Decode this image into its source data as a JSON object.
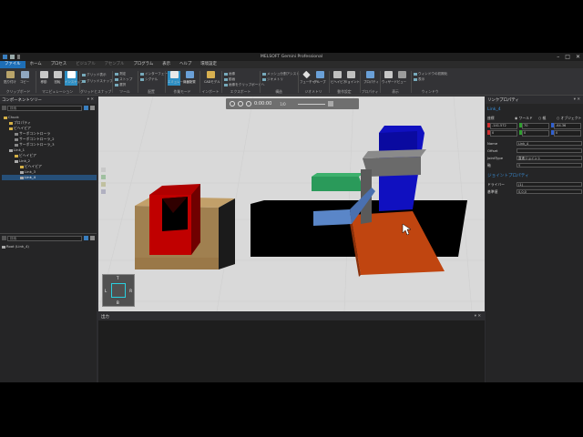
{
  "window": {
    "title": "MELSOFT Gemini Professional",
    "controls": [
      "–",
      "□",
      "✕"
    ]
  },
  "menu": [
    "ファイル",
    "ホーム",
    "プロセス",
    "ビジュアル",
    "アセンブル",
    "プログラム",
    "表示",
    "ヘルプ",
    "環境設定"
  ],
  "ribbon": {
    "groups": [
      {
        "label": "クリップボード",
        "buttons": [
          "貼り付け",
          "コピー"
        ]
      },
      {
        "label": "マニピュレーション",
        "buttons": [
          "移動",
          "回転",
          "インスナップ"
        ]
      },
      {
        "label": "グリッドとスナップ",
        "smalls": [
          "グリッド表示",
          "グリッドスナップ"
        ]
      },
      {
        "label": "ツール",
        "smalls": [
          "測定",
          "ストップ",
          "選択"
        ]
      },
      {
        "label": "配置",
        "smalls": [
          "インターフェース",
          "シグナル"
        ]
      },
      {
        "label": "作業モード",
        "buttons": [
          "エミュレーション",
          "機器配置"
        ]
      },
      {
        "label": "インポート",
        "buttons": [
          "CADモデル"
        ]
      },
      {
        "label": "エクスポート",
        "smalls": [
          "画像",
          "動画",
          "画像をクリップボードへ"
        ]
      },
      {
        "label": "構造",
        "smalls": [
          "メッシュ分割アシスト",
          "ジオメトリ"
        ]
      },
      {
        "label": "ジオメトリ",
        "buttons": [
          "フューチャー",
          "グループ"
        ]
      },
      {
        "label": "動作設定",
        "buttons": [
          "ビヘイビア",
          "ジョイント"
        ]
      },
      {
        "label": "プロパティ",
        "buttons": [
          "プロパティ"
        ]
      },
      {
        "label": "表示",
        "buttons": [
          "ウィザード",
          "ビュー"
        ]
      },
      {
        "label": "ウィンドウ",
        "smalls": [
          "ウィンドウの初期化",
          "表示"
        ]
      }
    ]
  },
  "left_panel": {
    "title": "コンポーネントツリー",
    "search_placeholder": "検索",
    "tree": [
      {
        "label": "Chuck",
        "depth": 0
      },
      {
        "label": "プロパティ",
        "depth": 1
      },
      {
        "label": "ビヘイビア",
        "depth": 1
      },
      {
        "label": "サーボコントローラ",
        "depth": 2
      },
      {
        "label": "サーボコントローラ_2",
        "depth": 2
      },
      {
        "label": "サーボコントローラ_3",
        "depth": 2
      },
      {
        "label": "Link_1",
        "depth": 1
      },
      {
        "label": "ビヘイビア",
        "depth": 2
      },
      {
        "label": "Link_2",
        "depth": 2
      },
      {
        "label": "ビヘイビア",
        "depth": 3
      },
      {
        "label": "Link_3",
        "depth": 3
      },
      {
        "label": "Link_4",
        "depth": 3,
        "selected": true
      }
    ],
    "search2_placeholder": "検索",
    "bottom_item": "Root (Link_4)"
  },
  "viewport": {
    "time": "0:00:00",
    "marker": "1/0",
    "navcube": {
      "top": "T",
      "left": "L",
      "right": "R",
      "bottom": "B"
    }
  },
  "output": {
    "title": "出力"
  },
  "right_panel": {
    "title": "リンクプロパティ",
    "link_name": "Link_4",
    "coord_label": "座標",
    "coord_options": [
      "ワールド",
      "親",
      "オブジェクト"
    ],
    "position": {
      "x": "-141.572",
      "y": "70",
      "z": "-64.36"
    },
    "rotation": {
      "x": "0",
      "y": "0",
      "z": "0"
    },
    "props": [
      {
        "label": "Name",
        "value": "Link_4"
      },
      {
        "label": "Offset",
        "value": ""
      },
      {
        "label": "JointType",
        "value": "直進ジョイント"
      },
      {
        "label": "軸",
        "value": "Y"
      }
    ],
    "joint_title": "ジョイントプロパティ",
    "joint_props": [
      {
        "label": "ドライバー",
        "value": "(1)"
      },
      {
        "label": "基準値",
        "value": "0,0,0"
      }
    ]
  },
  "colors": {
    "accent": "#2e8fc4",
    "red_box": "#b00000",
    "tan_base": "#a08050",
    "blue_column": "#1010c0",
    "orange_plate": "#c04510",
    "green_bar": "#2a9a5a",
    "light_blue": "#5a86c8",
    "gray_arm": "#6a6a6a"
  }
}
